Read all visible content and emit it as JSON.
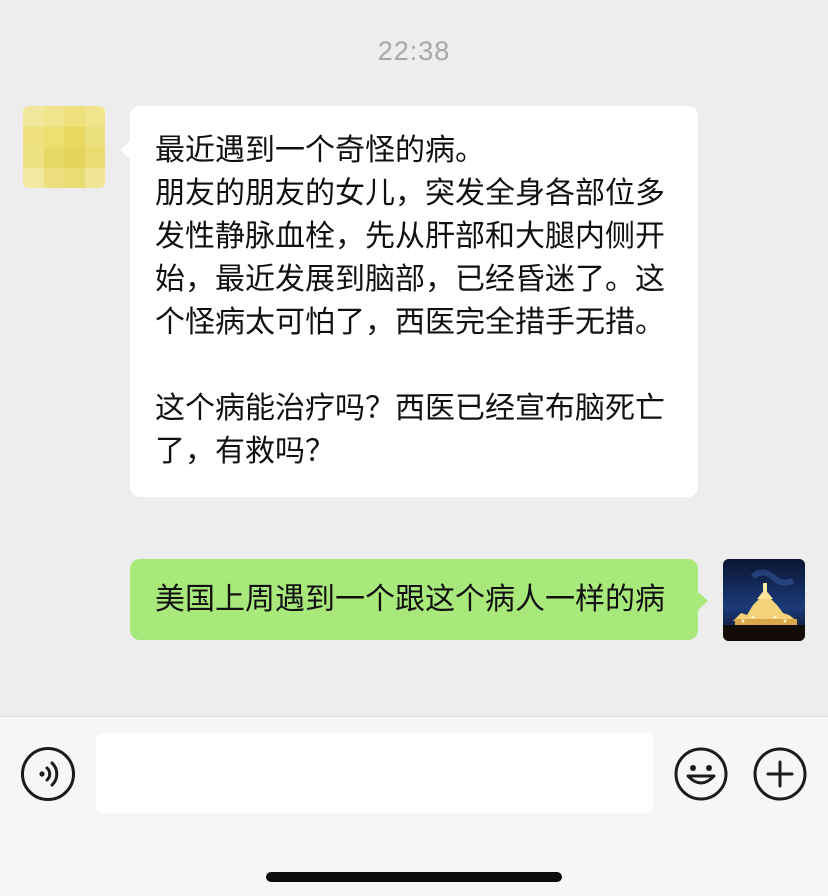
{
  "timestamp": "22:38",
  "messages": [
    {
      "side": "incoming",
      "avatar": "pixelated-yellow-avatar",
      "text": "最近遇到一个奇怪的病。\n朋友的朋友的女儿，突发全身各部位多发性静脉血栓，先从肝部和大腿内侧开始，最近发展到脑部，已经昏迷了。这个怪病太可怕了，西医完全措手无措。\n\n这个病能治疗吗？西医已经宣布脑死亡了，有救吗？"
    },
    {
      "side": "outgoing",
      "avatar": "temple-at-night-avatar",
      "text": "美国上周遇到一个跟这个病人一样的病"
    }
  ],
  "input_bar": {
    "input_value": "",
    "voice_icon": "voice-icon",
    "emoji_icon": "emoji-icon",
    "plus_icon": "plus-icon"
  },
  "colors": {
    "background": "#ededed",
    "incoming_bubble": "#ffffff",
    "outgoing_bubble": "#a9e97b",
    "timestamp": "#a8a8a8"
  }
}
